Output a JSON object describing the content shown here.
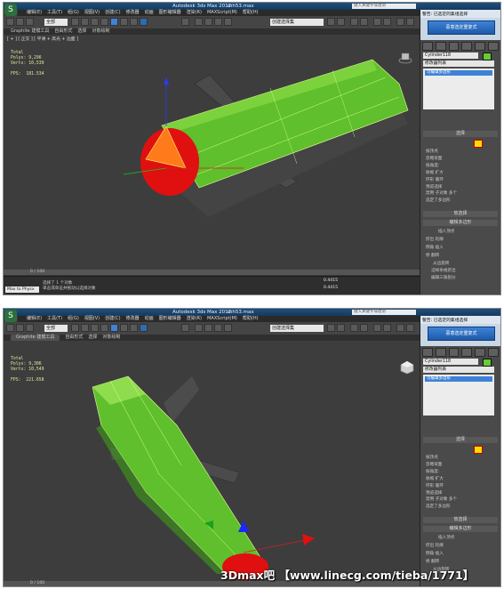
{
  "app": {
    "title": "Autodesk 3ds Max  2012",
    "file": "mh53.max",
    "search_placeholder": "键入关键字或短语",
    "icon_label": "S"
  },
  "menu": [
    "编辑(E)",
    "工具(T)",
    "组(G)",
    "视图(V)",
    "创建(C)",
    "修改器",
    "动画",
    "图形编辑器",
    "渲染(R)",
    "MAXScript(M)",
    "帮助(H)"
  ],
  "toolbar": {
    "selection_filter": "全部",
    "named_set": "创建选择集"
  },
  "ribbon_tabs": [
    "Graphite 建模工具",
    "自由形式",
    "选择",
    "对象绘制"
  ],
  "viewport_label": "[ + ] [ 正交 ] [ 平滑 + 高光 + 边面 ]",
  "stats": [
    {
      "total": "Total",
      "polys_label": "Polys:",
      "polys": "9,296",
      "verts_label": "Verts:",
      "verts": "10,539",
      "fps_label": "FPS:",
      "fps": "181.534"
    },
    {
      "total": "Total",
      "polys_label": "Polys:",
      "polys": "9,306",
      "verts_label": "Verts:",
      "verts": "10,549",
      "fps_label": "FPS:",
      "fps": "221.658"
    }
  ],
  "panel": {
    "dialog_title": "警告: 已选定的集组选择",
    "dialog_button": "恶意选定重复式",
    "object_name": "Cylinder118",
    "modifier_list": "修改器列表",
    "stack_item": "可编辑多边形",
    "sections": [
      "选择",
      "软选择",
      "编辑多边形"
    ],
    "rows": [
      "按顶点",
      "忽略背面",
      "按角度:",
      "收缩   扩大",
      "环形   循环",
      "预览选择",
      "禁用  子对象  多个",
      "选定了多边形"
    ],
    "edit_rows": [
      "插入顶点",
      "挤出   轮廓",
      "倒角   插入",
      "桥   翻转",
      "从边旋转",
      "沿样条线挤出",
      "编辑三角剖分"
    ]
  },
  "timeline": {
    "frame": "0 / 100",
    "maxscript": "Max to Physx",
    "status_line1": "选择了 1 个对象",
    "status_line2": "单击或单击并拖动以选择对象",
    "x_field": "0.4415",
    "y_field": "0.4415"
  },
  "watermark": "3Dmax吧 【www.linecg.com/tieba/1771】",
  "colors": {
    "accent_blue": "#3d83d8",
    "object_green": "#66cc33",
    "cap_red": "#e01010"
  }
}
